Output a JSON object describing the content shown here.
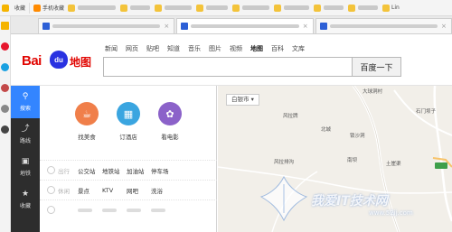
{
  "bookmarks": {
    "favorites_label": "收藏",
    "mobile_label": "手机收藏",
    "right_label": "Lin"
  },
  "browser_tabs": [
    {
      "label": "",
      "close": "×"
    },
    {
      "label": "",
      "close": "×"
    },
    {
      "label": "",
      "close": "×"
    }
  ],
  "header": {
    "nav_links": [
      "新闻",
      "网页",
      "贴吧",
      "知道",
      "音乐",
      "图片",
      "视频",
      "地图",
      "百科",
      "文库"
    ],
    "active_nav": "地图",
    "logo_text_bai": "Bai",
    "logo_text_du": "du",
    "logo_text_map": "地图",
    "search_value": "",
    "search_button_label": "百度一下"
  },
  "map_nav": [
    {
      "label": "搜索",
      "icon": "search-icon",
      "active": true
    },
    {
      "label": "路线",
      "icon": "route-icon",
      "active": false
    },
    {
      "label": "地铁",
      "icon": "subway-icon",
      "active": false
    },
    {
      "label": "收藏",
      "icon": "star-icon",
      "active": false
    }
  ],
  "quick_categories": [
    {
      "label": "找美食",
      "icon": "food-icon",
      "color": "#f07f4a"
    },
    {
      "label": "订酒店",
      "icon": "hotel-icon",
      "color": "#3aa5e0"
    },
    {
      "label": "看电影",
      "icon": "movie-icon",
      "color": "#8b62c9"
    }
  ],
  "category_rows": [
    {
      "category": "出行",
      "items": [
        "公交站",
        "地铁站",
        "加油站",
        "停车场"
      ]
    },
    {
      "category": "休闲",
      "items": [
        "景点",
        "KTV",
        "网吧",
        "洗浴"
      ]
    },
    {
      "category": "",
      "items": [
        "",
        "",
        "",
        ""
      ]
    }
  ],
  "map": {
    "city_selector": "白银市",
    "places": [
      "大球洞村",
      "风拉牌",
      "北城",
      "锁沙洞",
      "石门坝子",
      "风拉排沟",
      "南坝",
      "土崖渠"
    ]
  },
  "watermark": {
    "text": "我爱IT技术网",
    "url": "www.52ij.com"
  },
  "colors": {
    "accent_blue": "#3385ff",
    "baidu_red": "#e10602",
    "baidu_blue": "#2932e1"
  }
}
